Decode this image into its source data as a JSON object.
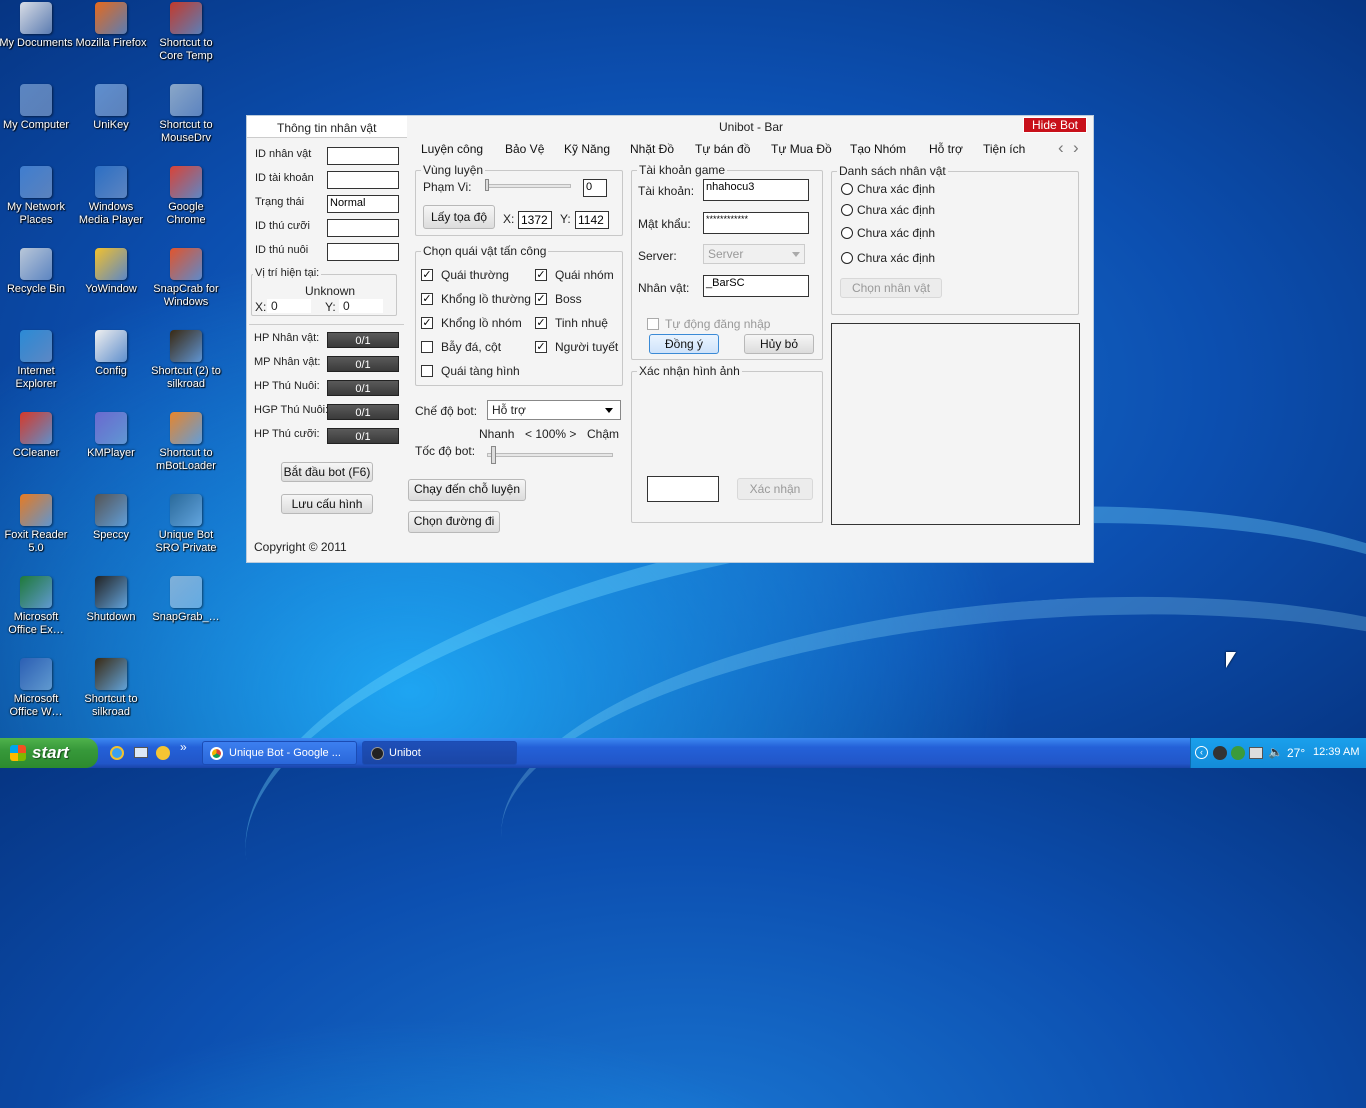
{
  "desktop": {
    "icons": [
      {
        "label": "My Documents",
        "icon": "folder-icon",
        "color": "#d9dde6"
      },
      {
        "label": "Mozilla Firefox",
        "icon": "firefox-icon",
        "color": "#e66a1d"
      },
      {
        "label": "Shortcut to Core Temp",
        "icon": "thermometer-icon",
        "color": "#c43a2c"
      },
      {
        "label": "My Computer",
        "icon": "computer-icon",
        "color": "#5b86c2"
      },
      {
        "label": "UniKey",
        "icon": "unikey-icon",
        "color": "#5f8fcf"
      },
      {
        "label": "Shortcut to MouseDrv",
        "icon": "mousedrv-icon",
        "color": "#8aa7c9"
      },
      {
        "label": "My Network Places",
        "icon": "network-icon",
        "color": "#3f7ed0"
      },
      {
        "label": "Windows Media Player",
        "icon": "media-player-icon",
        "color": "#2c6fc4"
      },
      {
        "label": "Google Chrome",
        "icon": "chrome-icon",
        "color": "#d94337"
      },
      {
        "label": "Recycle Bin",
        "icon": "recycle-bin-icon",
        "color": "#b9c7d9"
      },
      {
        "label": "YoWindow",
        "icon": "weather-icon",
        "color": "#f2c12e"
      },
      {
        "label": "SnapCrab for Windows",
        "icon": "camera-icon",
        "color": "#e2542c"
      },
      {
        "label": "Internet Explorer",
        "icon": "ie-icon",
        "color": "#2b8bd6"
      },
      {
        "label": "Config",
        "icon": "config-icon",
        "color": "#f0f0f0"
      },
      {
        "label": "Shortcut (2) to silkroad",
        "icon": "silkroad-icon",
        "color": "#3a2a12"
      },
      {
        "label": "CCleaner",
        "icon": "ccleaner-icon",
        "color": "#d63a2a"
      },
      {
        "label": "KMPlayer",
        "icon": "kmplayer-icon",
        "color": "#6a6ad0"
      },
      {
        "label": "Shortcut to mBotLoader",
        "icon": "mbotloader-icon",
        "color": "#e8862c"
      },
      {
        "label": "Foxit Reader 5.0",
        "icon": "foxit-icon",
        "color": "#e77b22"
      },
      {
        "label": "Speccy",
        "icon": "speccy-icon",
        "color": "#555"
      },
      {
        "label": "Unique Bot SRO Private",
        "icon": "unique-bot-icon",
        "color": "#2a6a9a"
      },
      {
        "label": "Microsoft Office Ex…",
        "icon": "excel-icon",
        "color": "#1f7a3a"
      },
      {
        "label": "Shutdown",
        "icon": "penguin-icon",
        "color": "#222"
      },
      {
        "label": "SnapGrab_…",
        "icon": "image-icon",
        "color": "#7fb0d9"
      },
      {
        "label": "Microsoft Office W…",
        "icon": "word-icon",
        "color": "#2b5fb4"
      },
      {
        "label": "Shortcut to silkroad",
        "icon": "silkroad-icon",
        "color": "#3a2a12"
      }
    ]
  },
  "window": {
    "title": "Unibot - Bar",
    "hide_button": "Hide Bot",
    "left_panel": {
      "heading": "Thông tin nhân vật",
      "fields": [
        {
          "label": "ID nhân vật",
          "value": ""
        },
        {
          "label": "ID tài khoản",
          "value": ""
        },
        {
          "label": "Trạng thái",
          "value": "Normal"
        },
        {
          "label": "ID thú cưỡi",
          "value": ""
        },
        {
          "label": "ID thú nuôi",
          "value": ""
        }
      ],
      "position_title": "Vị trí hiện tại:",
      "position_value": "Unknown",
      "x_label": "X:",
      "x_value": "0",
      "y_label": "Y:",
      "y_value": "0",
      "bars": [
        {
          "label": "HP Nhân vật:",
          "value": "0/1"
        },
        {
          "label": "MP Nhân vật:",
          "value": "0/1"
        },
        {
          "label": "HP Thú Nuôi:",
          "value": "0/1"
        },
        {
          "label": "HGP Thú Nuôi:",
          "value": "0/1"
        },
        {
          "label": "HP Thú cưỡi:",
          "value": "0/1"
        }
      ],
      "start_button": "Bắt đầu bot (F6)",
      "save_button": "Lưu cấu hình",
      "copyright": "Copyright © 2011"
    },
    "tabs": [
      "Luyện công",
      "Bảo Vệ",
      "Kỹ Năng",
      "Nhặt Đồ",
      "Tự bán đồ",
      "Tự Mua Đồ",
      "Tạo Nhóm",
      "Hỗ trợ",
      "Tiện ích"
    ],
    "tab_prev": "‹",
    "tab_next": "›",
    "training": {
      "area_title": "Vùng luyện",
      "range_label": "Phạm Vi:",
      "range_value": "0",
      "get_coords_button": "Lấy tọa độ",
      "x_label": "X:",
      "x_value": "1372",
      "y_label": "Y:",
      "y_value": "1142",
      "monster_title": "Chọn quái vật tấn công",
      "monsters": [
        {
          "label": "Quái thường",
          "checked": true
        },
        {
          "label": "Quái nhóm",
          "checked": true
        },
        {
          "label": "Khổng lồ thường",
          "checked": true
        },
        {
          "label": "Boss",
          "checked": true
        },
        {
          "label": "Khổng lồ nhóm",
          "checked": true
        },
        {
          "label": "Tinh nhuệ",
          "checked": true
        },
        {
          "label": "Bẫy đá, cột",
          "checked": false
        },
        {
          "label": "Người tuyết",
          "checked": true
        },
        {
          "label": "Quái tàng hình",
          "checked": false
        }
      ],
      "mode_label": "Chế độ bot:",
      "mode_value": "Hỗ trợ",
      "speed_fast": "Nhanh",
      "speed_value": "< 100% >",
      "speed_slow": "Chậm",
      "speed_label": "Tốc độ bot:",
      "goto_button": "Chạy đến chỗ luyện",
      "path_button": "Chọn đường đi"
    },
    "account": {
      "title": "Tài khoản game",
      "user_label": "Tài khoản:",
      "user_value": "nhahocu3",
      "pass_label": "Mật khẩu:",
      "pass_value": "************",
      "server_label": "Server:",
      "server_value": "Server",
      "char_label": "Nhân vật:",
      "char_value": "_BarSC",
      "auto_login": "Tự động đăng nhập",
      "ok_button": "Đồng ý",
      "cancel_button": "Hủy bỏ",
      "captcha_title": "Xác nhận hình ảnh",
      "captcha_button": "Xác nhận"
    },
    "characters": {
      "title": "Danh sách nhân vật",
      "items": [
        "Chưa xác định",
        "Chưa xác định",
        "Chưa xác định",
        "Chưa xác định"
      ],
      "select_button": "Chọn nhân vật"
    }
  },
  "taskbar": {
    "start_label": "start",
    "tasks": [
      "Unique Bot - Google ...",
      "Unibot"
    ],
    "temperature": "27°",
    "clock": "12:39 AM"
  }
}
